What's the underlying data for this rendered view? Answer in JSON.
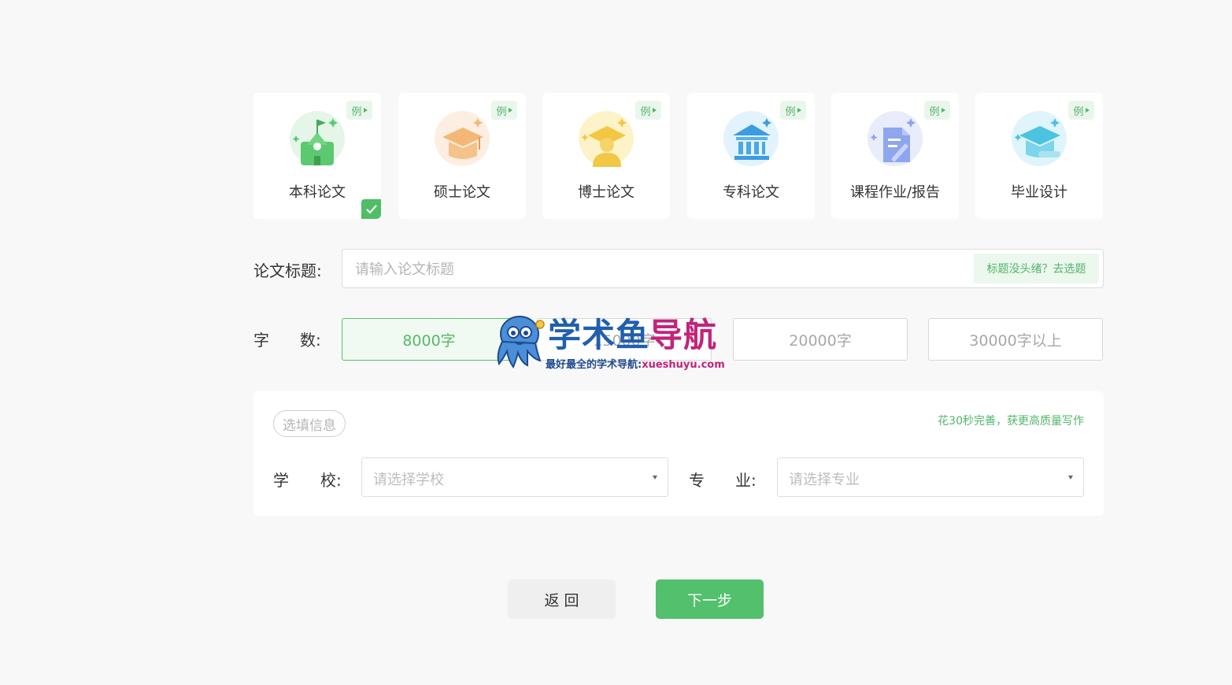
{
  "cards": [
    {
      "label": "本科论文",
      "badge": "例",
      "selected": true
    },
    {
      "label": "硕士论文",
      "badge": "例",
      "selected": false
    },
    {
      "label": "博士论文",
      "badge": "例",
      "selected": false
    },
    {
      "label": "专科论文",
      "badge": "例",
      "selected": false
    },
    {
      "label": "课程作业/报告",
      "badge": "例",
      "selected": false
    },
    {
      "label": "毕业设计",
      "badge": "例",
      "selected": false
    }
  ],
  "title_row": {
    "label": "论文标题:",
    "placeholder": "请输入论文标题",
    "helper_link": "标题没头绪？去选题"
  },
  "wordcount": {
    "label_a": "字",
    "label_b": "数:",
    "options": [
      "8000字",
      "15000字",
      "20000字",
      "30000字以上"
    ],
    "selected": "8000字"
  },
  "optional": {
    "tag": "选填信息",
    "hint": "花30秒完善，获更高质量写作",
    "school_label_a": "学",
    "school_label_b": "校:",
    "school_placeholder": "请选择学校",
    "major_label_a": "专",
    "major_label_b": "业:",
    "major_placeholder": "请选择专业"
  },
  "buttons": {
    "back": "返 回",
    "next": "下一步"
  },
  "watermark": {
    "title_blue": "学术鱼",
    "title_pink": "导航",
    "sub": "最好最全的学术导航:",
    "url": "xueshuyu.com"
  },
  "colors": {
    "accent": "#52c06c",
    "accent_text": "#52b56a",
    "background": "#f8f8f8"
  }
}
